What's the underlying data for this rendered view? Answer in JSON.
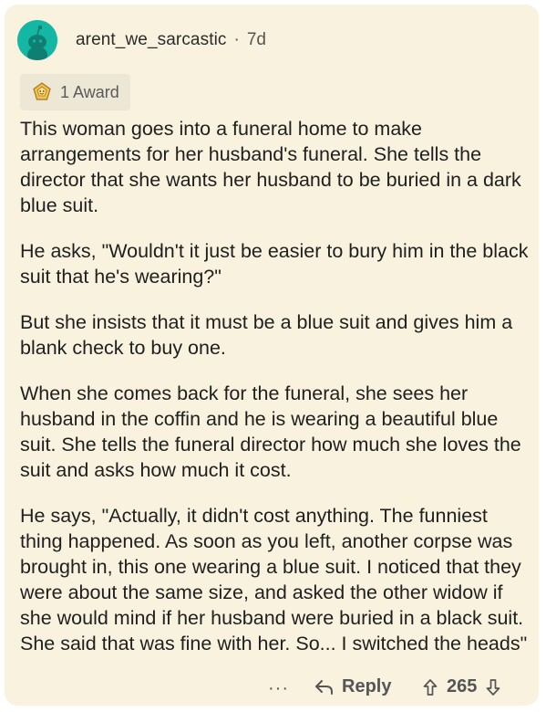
{
  "comment": {
    "username": "arent_we_sarcastic",
    "separator": "·",
    "age": "7d",
    "award_label": "1 Award",
    "paragraphs": [
      "This woman goes into a funeral home to make arrangements for her husband's funeral. She tells the director that she wants her husband to be buried in a dark blue suit.",
      "He asks, \"Wouldn't it just be easier to bury him in the black suit that he's wearing?\"",
      "But she insists that it must be a blue suit and gives him a blank check to buy one.",
      "When she comes back for the funeral, she sees her husband in the coffin and he is wearing a beautiful blue suit. She tells the funeral director how much she loves the suit and asks how much it cost.",
      "He says, \"Actually, it didn't cost anything. The funniest thing happened. As soon as you left, another corpse was brought in, this one wearing a blue suit. I noticed that they were about the same size, and asked the other widow if she would mind if her husband were buried in a black suit. She said that was fine with her. So... I switched the heads\""
    ]
  },
  "actions": {
    "more_label": "···",
    "reply_label": "Reply",
    "score": "265"
  },
  "colors": {
    "card_background": "#f8f2df",
    "avatar": "#14b6a4",
    "text": "#1f1f1f",
    "muted": "#555555",
    "award_background": "#ede7d5"
  }
}
